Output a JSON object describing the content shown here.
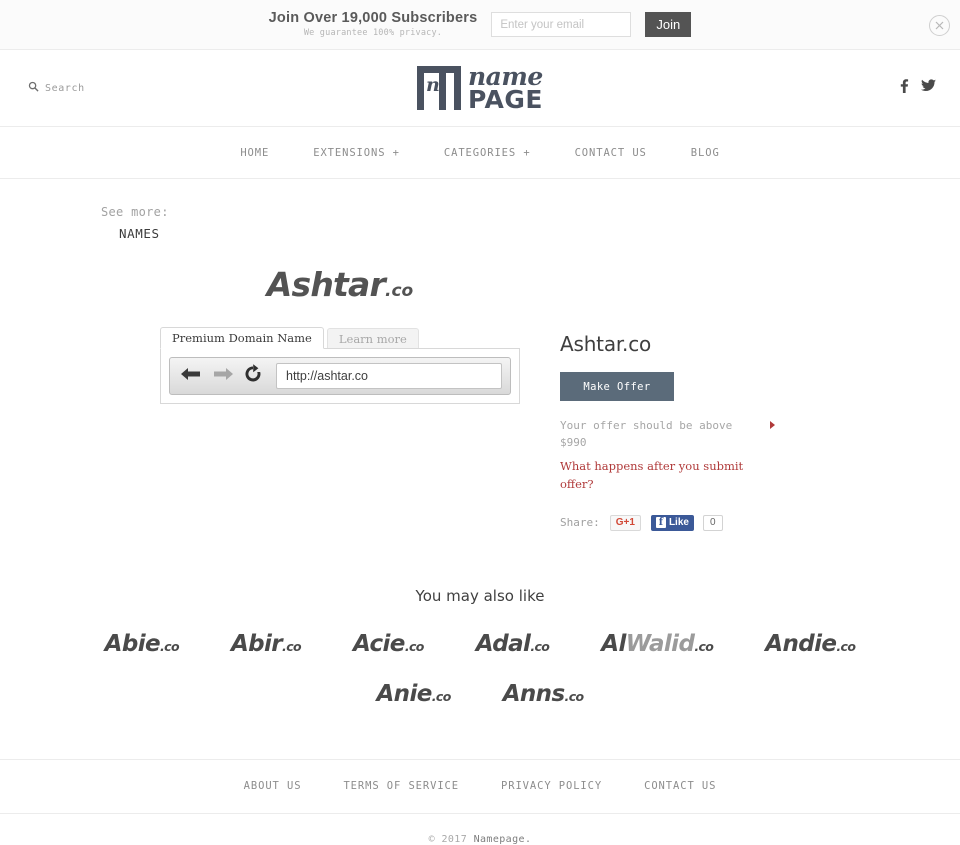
{
  "subscribe_bar": {
    "title": "Join Over 19,000 Subscribers",
    "subtitle": "We guarantee 100% privacy.",
    "email_placeholder": "Enter your email",
    "email_value": "",
    "join_label": "Join",
    "close_icon": "close-circle-icon"
  },
  "header": {
    "search_label": "Search",
    "search_icon": "search-icon",
    "logo_mark_letter": "n",
    "logo_name": "name",
    "logo_page": "PAGE",
    "social": [
      {
        "name": "facebook-icon",
        "label": "f"
      },
      {
        "name": "twitter-icon",
        "label": "t"
      }
    ]
  },
  "nav": {
    "items": [
      {
        "label": "HOME"
      },
      {
        "label": "EXTENSIONS +"
      },
      {
        "label": "CATEGORIES +"
      },
      {
        "label": "CONTACT US"
      },
      {
        "label": "BLOG"
      }
    ]
  },
  "see_more": {
    "label": "See more:",
    "value": "NAMES"
  },
  "hero": {
    "name": "Ashtar",
    "tld": ".co"
  },
  "browser_mock": {
    "tab_active": "Premium Domain Name",
    "tab_inactive": "Learn more",
    "url": "http://ashtar.co",
    "back_icon": "arrow-back-icon",
    "forward_icon": "arrow-forward-icon",
    "reload_icon": "reload-icon"
  },
  "offer": {
    "domain": "Ashtar.co",
    "button_label": "Make Offer",
    "note_line1": "Your offer should be above",
    "note_line2": "$990",
    "link_label": "What happens after you submit offer?",
    "arrow_color": "#b03a3a",
    "link_color": "#b03a3a",
    "button_color": "#5b6b7a",
    "share_label": "Share:",
    "gplus_label": "G+1",
    "fb_like_label": "Like",
    "fb_count": "0"
  },
  "also_like": {
    "title": "You may also like",
    "items": [
      {
        "name": "Abie",
        "tld": ".co",
        "dim_prefix": ""
      },
      {
        "name": "Abir",
        "tld": ".co",
        "dim_prefix": ""
      },
      {
        "name": "Acie",
        "tld": ".co",
        "dim_prefix": ""
      },
      {
        "name": "Adal",
        "tld": ".co",
        "dim_prefix": ""
      },
      {
        "name": "Walid",
        "tld": ".co",
        "dim_prefix": "Al"
      },
      {
        "name": "Andie",
        "tld": ".co",
        "dim_prefix": ""
      },
      {
        "name": "Anie",
        "tld": ".co",
        "dim_prefix": ""
      },
      {
        "name": "Anns",
        "tld": ".co",
        "dim_prefix": ""
      }
    ]
  },
  "footer": {
    "links": [
      {
        "label": "ABOUT US"
      },
      {
        "label": "TERMS OF SERVICE"
      },
      {
        "label": "PRIVACY POLICY"
      },
      {
        "label": "CONTACT US"
      }
    ],
    "copyright_prefix": "© 2017 ",
    "copyright_brand": "Namepage."
  }
}
